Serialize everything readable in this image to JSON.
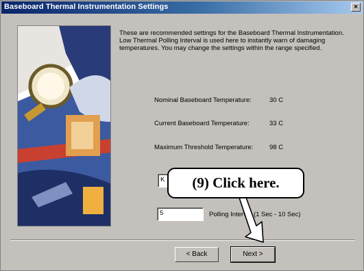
{
  "window": {
    "title": "Baseboard Thermal Instrumentation Settings",
    "close_glyph": "×"
  },
  "description": "These are recommended settings for the Baseboard Thermal Instrumentation. Low Thermal Polling Interval is used here to instantly warn of damaging temperatures. You may change the settings within the range specified.",
  "readings": [
    {
      "label": "Nominal Baseboard Temperature:",
      "value": "30 C"
    },
    {
      "label": "Current Baseboard Temperature:",
      "value": "33 C"
    },
    {
      "label": "Maximum Threshold Temperature:",
      "value": "98 C"
    }
  ],
  "fields": {
    "threshold_value": "K",
    "polling_value": "5",
    "polling_label": "Polling Interval (1 Sec - 10 Sec)"
  },
  "buttons": {
    "back": "< Back",
    "next": "Next >"
  },
  "callout": {
    "text": "(9)  Click here."
  }
}
